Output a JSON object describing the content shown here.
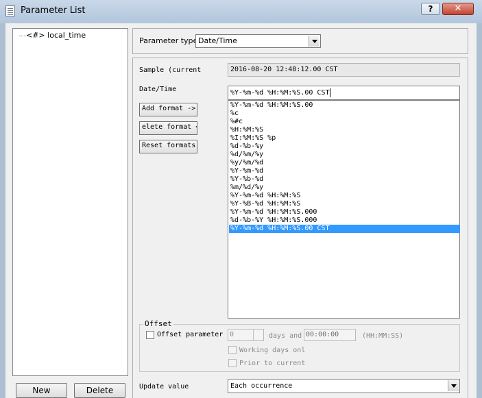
{
  "window": {
    "title": "Parameter List",
    "help_label": "?",
    "close_label": "✕"
  },
  "tree": {
    "node_prefix": "<#>",
    "node_label": "local_time"
  },
  "buttons": {
    "new_label": "New",
    "delete_label": "Delete"
  },
  "parameter_type": {
    "label": "Parameter type:",
    "value": "Date/Time"
  },
  "sample": {
    "label": "Sample (current",
    "value": "2016-08-20 12:48:12.00 CST"
  },
  "datetime": {
    "label": "Date/Time",
    "value": "%Y-%m-%d %H:%M:%S.00 CST"
  },
  "format_buttons": {
    "add": "Add format ->",
    "delete": "elete format <",
    "reset": "Reset formats"
  },
  "formats": [
    "%Y-%m-%d %H:%M:%S.00",
    "%c",
    "%#c",
    "%H:%M:%S",
    "%I:%M:%S %p",
    "%d-%b-%y",
    "%d/%m/%y",
    "%y/%m/%d",
    "%Y-%m-%d",
    "%Y-%b-%d",
    "%m/%d/%y",
    "%Y-%m-%d %H:%M:%S",
    "%Y-%B-%d %H:%M:%S",
    "%Y-%m-%d %H:%M:%S.000",
    "%d-%b-%Y %H:%M:%S.000",
    "%Y-%m-%d %H:%M:%S.00 CST"
  ],
  "selected_format_index": 15,
  "offset": {
    "legend": "Offset",
    "checkbox_label": "Offset parameter",
    "days_value": "0",
    "days_label": "days and",
    "time_value": "00:00:00",
    "time_format": "(HH:MM:SS)",
    "working_days_label": "Working days onl",
    "prior_label": "Prior to current"
  },
  "update": {
    "label": "Update value",
    "value": "Each occurrence"
  },
  "colors": {
    "selection": "#3399ff",
    "titlebar": "#b9cbe0",
    "close": "#c5432f"
  }
}
